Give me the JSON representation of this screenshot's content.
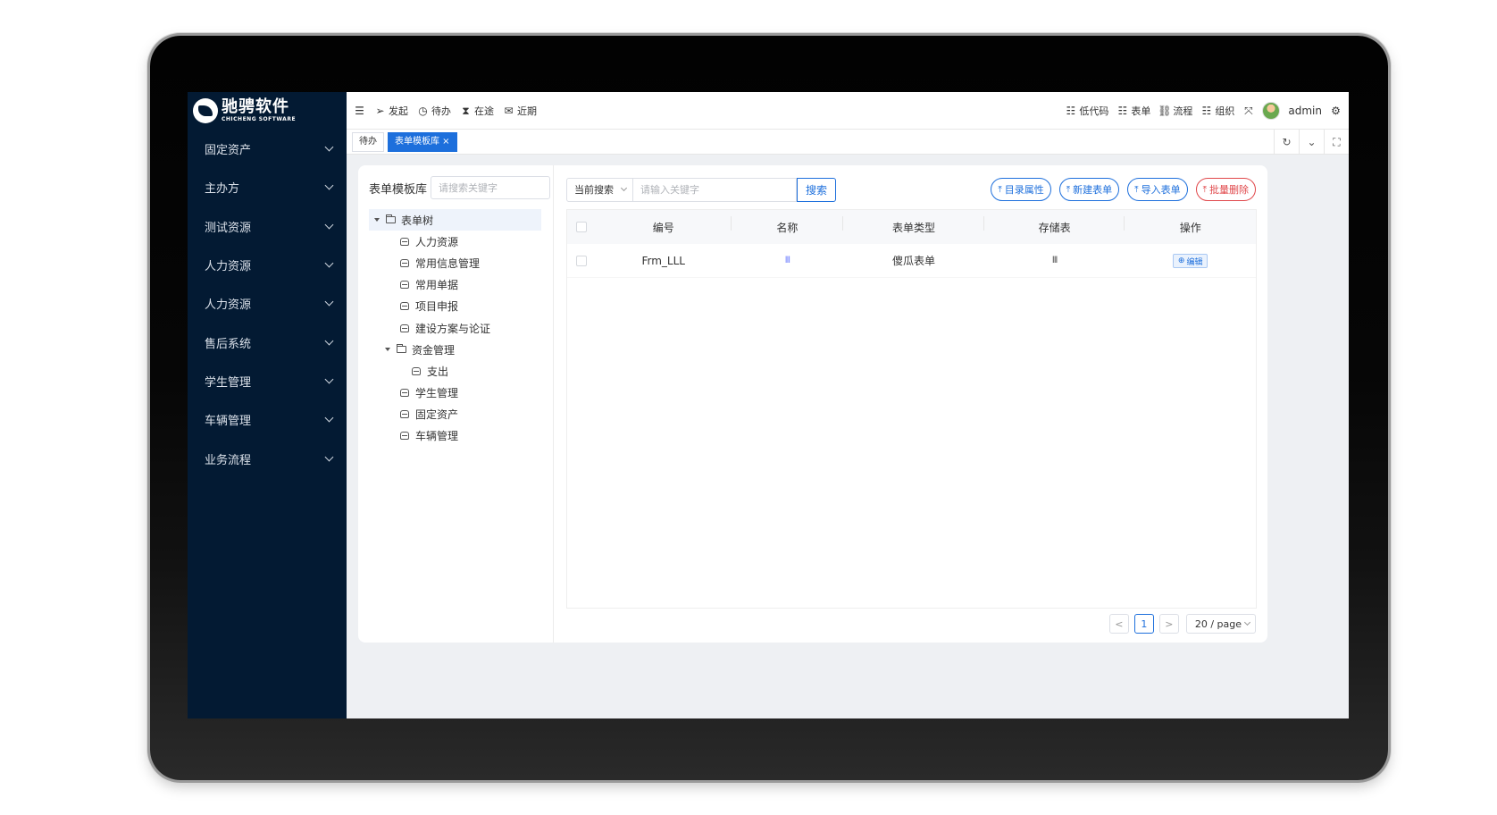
{
  "brand": {
    "name_cn": "驰骋软件",
    "name_en": "CHICHENG SOFTWARE"
  },
  "sidebar": {
    "items": [
      {
        "label": "固定资产"
      },
      {
        "label": "主办方"
      },
      {
        "label": "测试资源"
      },
      {
        "label": "人力资源"
      },
      {
        "label": "人力资源"
      },
      {
        "label": "售后系统"
      },
      {
        "label": "学生管理"
      },
      {
        "label": "车辆管理"
      },
      {
        "label": "业务流程"
      }
    ]
  },
  "topbar": {
    "left": [
      {
        "label": "发起",
        "icon": "send-icon"
      },
      {
        "label": "待办",
        "icon": "clock-icon"
      },
      {
        "label": "在途",
        "icon": "hourglass-icon"
      },
      {
        "label": "近期",
        "icon": "mail-icon"
      }
    ],
    "right": [
      {
        "label": "低代码",
        "icon": "list-icon"
      },
      {
        "label": "表单",
        "icon": "list-icon"
      },
      {
        "label": "流程",
        "icon": "flow-icon"
      },
      {
        "label": "组织",
        "icon": "list-icon"
      }
    ],
    "user": "admin"
  },
  "tabs": [
    {
      "label": "待办"
    },
    {
      "label": "表单模板库 ×"
    }
  ],
  "left_panel": {
    "title": "表单模板库",
    "search_placeholder": "请搜索关键字",
    "tree": {
      "root": "表单树",
      "children": [
        "人力资源",
        "常用信息管理",
        "常用单据",
        "项目申报",
        "建设方案与论证"
      ],
      "folder": "资金管理",
      "folder_children": [
        "支出"
      ],
      "tail": [
        "学生管理",
        "固定资产",
        "车辆管理"
      ]
    }
  },
  "toolbar": {
    "scope": "当前搜索",
    "search_placeholder": "请输入关键字",
    "search_button": "搜索",
    "actions": [
      "目录属性",
      "新建表单",
      "导入表单",
      "批量删除"
    ]
  },
  "table": {
    "columns": [
      "编号",
      "名称",
      "表单类型",
      "存储表",
      "操作"
    ],
    "rows": [
      {
        "code": "Frm_LLL",
        "name": "lll",
        "type": "傻瓜表单",
        "store": "lll",
        "op": "编辑"
      }
    ]
  },
  "pagination": {
    "current": "1",
    "page_size": "20 / page",
    "prev": "<",
    "next": ">"
  },
  "colors": {
    "sidebar_bg": "#031a33",
    "accent": "#1d6fdc",
    "danger": "#e0474a"
  }
}
